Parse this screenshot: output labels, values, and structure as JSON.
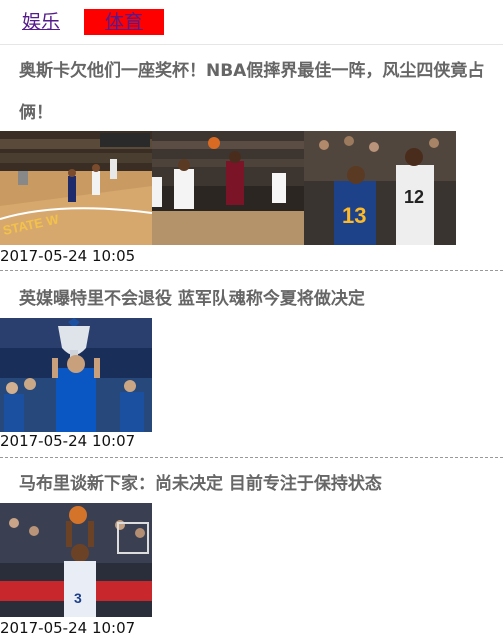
{
  "tabs": [
    {
      "label": "娱乐"
    },
    {
      "label": "体育"
    }
  ],
  "articles": [
    {
      "title": "奥斯卡欠他们一座奖杯！NBA假摔界最佳一阵，风尘四侠竟占俩！",
      "date": "2017-05-24 10:05",
      "thumbnail_count": 3
    },
    {
      "title": "英媒曝特里不会退役 蓝军队魂称今夏将做决定",
      "date": "2017-05-24 10:07",
      "thumbnail_count": 1
    },
    {
      "title": "马布里谈新下家：尚未决定 目前专注于保持状态",
      "date": "2017-05-24 10:07",
      "thumbnail_count": 1
    }
  ],
  "colors": {
    "active_tab_bg": "#ff0000",
    "tab_link": "#551a8b",
    "title_text": "#666666",
    "warriors_blue": "#1d428a",
    "warriors_gold": "#fdb927"
  }
}
